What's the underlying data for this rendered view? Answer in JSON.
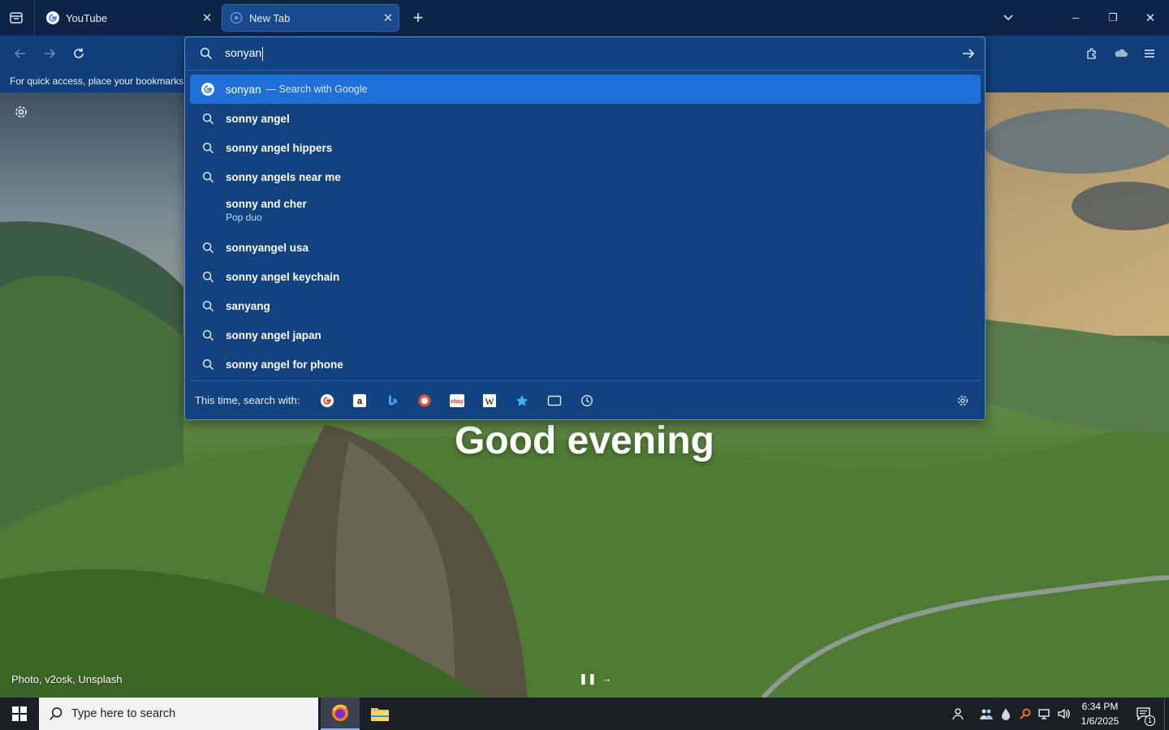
{
  "tabs": [
    {
      "title": "YouTube",
      "favicon": "google-g-icon",
      "close": "✕"
    },
    {
      "title": "New Tab",
      "favicon": "firefox-icon",
      "close": "✕"
    }
  ],
  "toolbar": {
    "new_tab": "+",
    "list_tabs": "chevron-down-icon"
  },
  "window": {
    "minimize": "─",
    "restore": "❐",
    "close": "✕"
  },
  "bookmarks_bar": {
    "text": "For quick access, place your bookmarks here on the bookmarks toolbar."
  },
  "urlbar": {
    "value": "sonyan"
  },
  "suggestions": [
    {
      "text": "sonyan",
      "suffix": "— Search with Google",
      "icon": "google-g-icon",
      "selected": true
    },
    {
      "text": "sonny angel",
      "icon": "search-icon"
    },
    {
      "text": "sonny angel hippers",
      "icon": "search-icon"
    },
    {
      "text": "sonny angels near me",
      "icon": "search-icon"
    },
    {
      "text": "sonny and cher",
      "sub": "Pop duo",
      "icon": "none"
    },
    {
      "text": "sonnyangel usa",
      "icon": "search-icon"
    },
    {
      "text": "sonny angel keychain",
      "icon": "search-icon"
    },
    {
      "text": "sanyang",
      "icon": "search-icon"
    },
    {
      "text": "sonny angel japan",
      "icon": "search-icon"
    },
    {
      "text": "sonny angel for phone",
      "icon": "search-icon"
    }
  ],
  "oneoff": {
    "label": "This time, search with:",
    "engines": [
      "google-icon",
      "amazon-icon",
      "bing-icon",
      "duckduckgo-icon",
      "ebay-icon",
      "wikipedia-icon",
      "bookmarks-star-icon",
      "tabs-icon",
      "history-icon"
    ]
  },
  "newtab": {
    "greeting": "Good evening",
    "credit": "Photo, v2osk, Unsplash"
  },
  "taskbar": {
    "search_placeholder": "Type here to search",
    "time": "6:34 PM",
    "date": "1/6/2025",
    "notifications": "1"
  },
  "colors": {
    "titlebar": "#0e2447",
    "navbar": "#113e7a",
    "panel": "#12427f",
    "selected": "#1f6fd8",
    "taskbar": "#1a1f26"
  }
}
